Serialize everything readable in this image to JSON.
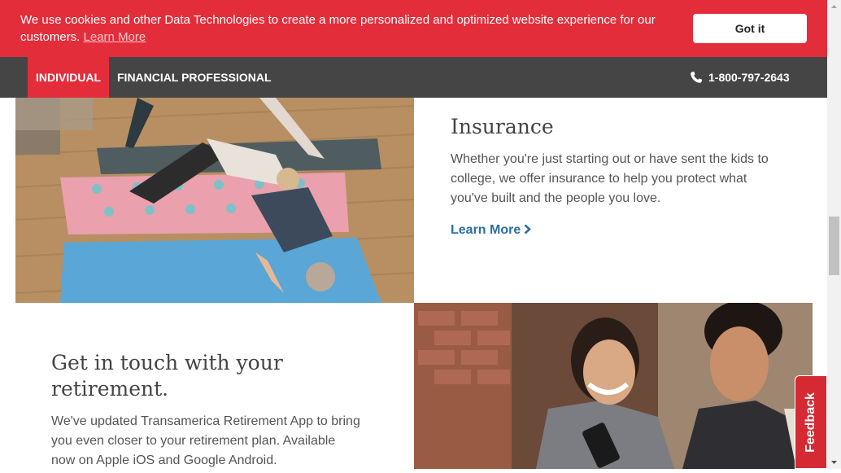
{
  "cookie_banner": {
    "message": "We use cookies and other Data Technologies to create a more personalized and optimized website experience for our customers.",
    "link_label": "Learn More",
    "button_label": "Got it"
  },
  "nav": {
    "tabs": [
      {
        "label": "INDIVIDUAL",
        "active": true
      },
      {
        "label": "FINANCIAL PROFESSIONAL",
        "active": false
      }
    ],
    "phone": "1-800-797-2643",
    "phone_icon": "phone-icon"
  },
  "insurance": {
    "heading": "Insurance",
    "text": "Whether you're just starting out or have sent the kids to college, we offer insurance to help you protect what you've built and the people you love.",
    "link_label": "Learn More",
    "link_icon": "chevron-right-icon"
  },
  "app_promo": {
    "heading": "Get in touch with your retirement.",
    "text": "We've updated Transamerica Retirement App to bring you even closer to your retirement plan. Available now on Apple iOS and Google Android."
  },
  "feedback": {
    "label": "Feedback"
  },
  "colors": {
    "brand_red": "#e42d3a",
    "nav_gray": "#454545",
    "link_blue": "#2d6fa3"
  }
}
